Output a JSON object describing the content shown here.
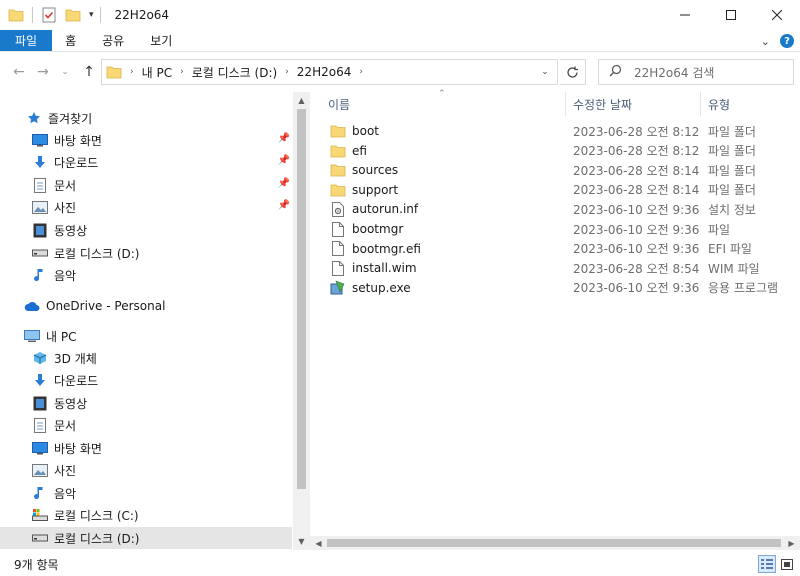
{
  "window": {
    "title": "22H2o64"
  },
  "ribbon": {
    "tabs": [
      "파일",
      "홈",
      "공유",
      "보기"
    ],
    "help": "?"
  },
  "address": {
    "segments": [
      "내 PC",
      "로컬 디스크 (D:)",
      "22H2o64"
    ]
  },
  "search": {
    "placeholder": "22H2o64 검색"
  },
  "nav": {
    "quick_access": "즐겨찾기",
    "quick_items": [
      "바탕 화면",
      "다운로드",
      "문서",
      "사진",
      "동영상",
      "로컬 디스크 (D:)",
      "음악"
    ],
    "onedrive": "OneDrive - Personal",
    "this_pc": "내 PC",
    "pc_items": [
      "3D 개체",
      "다운로드",
      "동영상",
      "문서",
      "바탕 화면",
      "사진",
      "음악",
      "로컬 디스크 (C:)",
      "로컬 디스크 (D:)"
    ]
  },
  "columns": {
    "name": "이름",
    "date": "수정한 날짜",
    "type": "유형"
  },
  "files": [
    {
      "name": "boot",
      "date": "2023-06-28 오전 8:12",
      "type": "파일 폴더",
      "icon": "folder-icon"
    },
    {
      "name": "efi",
      "date": "2023-06-28 오전 8:12",
      "type": "파일 폴더",
      "icon": "folder-icon"
    },
    {
      "name": "sources",
      "date": "2023-06-28 오전 8:14",
      "type": "파일 폴더",
      "icon": "folder-icon"
    },
    {
      "name": "support",
      "date": "2023-06-28 오전 8:14",
      "type": "파일 폴더",
      "icon": "folder-icon"
    },
    {
      "name": "autorun.inf",
      "date": "2023-06-10 오전 9:36",
      "type": "설치 정보",
      "icon": "settings-file-icon"
    },
    {
      "name": "bootmgr",
      "date": "2023-06-10 오전 9:36",
      "type": "파일",
      "icon": "file-icon"
    },
    {
      "name": "bootmgr.efi",
      "date": "2023-06-10 오전 9:36",
      "type": "EFI 파일",
      "icon": "file-icon"
    },
    {
      "name": "install.wim",
      "date": "2023-06-28 오전 8:54",
      "type": "WIM 파일",
      "icon": "file-icon"
    },
    {
      "name": "setup.exe",
      "date": "2023-06-10 오전 9:36",
      "type": "응용 프로그램",
      "icon": "setup-icon"
    }
  ],
  "status": {
    "count": "9개 항목"
  },
  "colors": {
    "accent": "#1979ca",
    "folder": "#f8d775",
    "selection": "#cce8ff"
  }
}
